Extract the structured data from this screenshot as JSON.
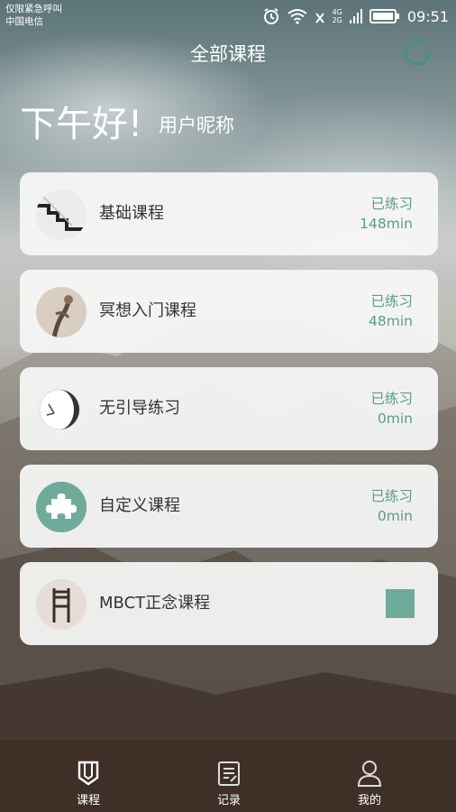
{
  "status_bar": {
    "carrier_line1": "仅限紧急呼叫",
    "carrier_line2": "中国电信",
    "network_4g": "4G",
    "network_2g": "2G",
    "time": "09:51"
  },
  "header": {
    "title": "全部课程"
  },
  "greeting": {
    "main": "下午好!",
    "nickname": "用户昵称"
  },
  "courses": [
    {
      "name": "基础课程",
      "status": "已练习",
      "duration": "148min",
      "thumb": "stairs"
    },
    {
      "name": "冥想入门课程",
      "status": "已练习",
      "duration": "48min",
      "thumb": "hand-flower"
    },
    {
      "name": "无引导练习",
      "status": "已练习",
      "duration": "0min",
      "thumb": "clock-moon"
    },
    {
      "name": "自定义课程",
      "status": "已练习",
      "duration": "0min",
      "thumb": "puzzle"
    },
    {
      "name": "MBCT正念课程",
      "thumb": "chair"
    }
  ],
  "tabs": [
    {
      "label": "课程",
      "icon": "book-icon",
      "active": true
    },
    {
      "label": "记录",
      "icon": "note-icon",
      "active": false
    },
    {
      "label": "我的",
      "icon": "user-icon",
      "active": false
    }
  ],
  "colors": {
    "accent": "#5b9c8c",
    "square": "#6fab9b",
    "card_bg": "#f6f6f6"
  }
}
